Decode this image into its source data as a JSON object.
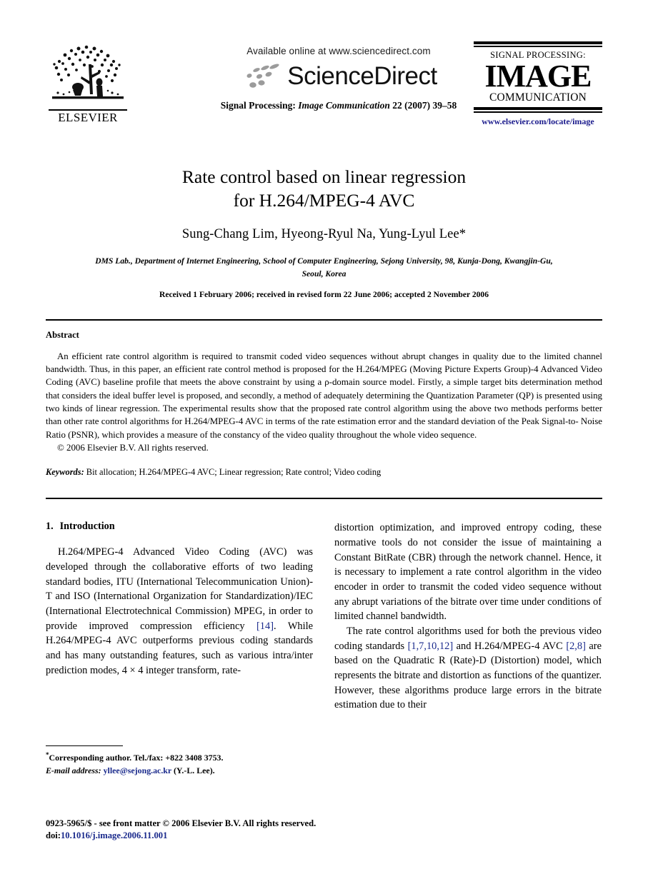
{
  "masthead": {
    "publisher_logo_text": "ELSEVIER",
    "available_online": "Available online at www.sciencedirect.com",
    "sciencedirect_wordmark": "ScienceDirect",
    "journal_ref_prefix": "Signal Processing: ",
    "journal_ref_italic": "Image Communication",
    "journal_ref_suffix": " 22 (2007) 39–58",
    "journal_logo_line1": "SIGNAL PROCESSING:",
    "journal_logo_line2": "IMAGE",
    "journal_logo_line3": "COMMUNICATION",
    "journal_url": "www.elsevier.com/locate/image"
  },
  "article": {
    "title_line1": "Rate control based on linear regression",
    "title_line2": "for H.264/MPEG-4 AVC",
    "authors": "Sung-Chang Lim, Hyeong-Ryul Na, Yung-Lyul Lee*",
    "affiliation_line1": "DMS Lab., Department of Internet Engineering, School of Computer Engineering, Sejong University, 98, Kunja-Dong,",
    "affiliation_line2": "Kwangjin-Gu, Seoul, Korea",
    "history": "Received 1 February 2006; received in revised form 22 June 2006; accepted 2 November 2006"
  },
  "abstract": {
    "heading": "Abstract",
    "paragraph": "An efficient rate control algorithm is required to transmit coded video sequences without abrupt changes in quality due to the limited channel bandwidth. Thus, in this paper, an efficient rate control method is proposed for the H.264/MPEG (Moving Picture Experts Group)-4 Advanced Video Coding (AVC) baseline profile that meets the above constraint by using a ρ-domain source model. Firstly, a simple target bits determination method that considers the ideal buffer level is proposed, and secondly, a method of adequately determining the Quantization Parameter (QP) is presented using two kinds of linear regression. The experimental results show that the proposed rate control algorithm using the above two methods performs better than other rate control algorithms for H.264/MPEG-4 AVC in terms of the rate estimation error and the standard deviation of the Peak Signal-to- Noise Ratio (PSNR), which provides a measure of the constancy of the video quality throughout the whole video sequence.",
    "copyright": "© 2006 Elsevier B.V. All rights reserved.",
    "keywords_label": "Keywords:",
    "keywords_value": " Bit allocation; H.264/MPEG-4 AVC; Linear regression; Rate control; Video coding"
  },
  "body": {
    "section_number": "1.",
    "section_title": "Introduction",
    "left_p1_a": "H.264/MPEG-4 Advanced Video Coding (AVC) was developed through the collaborative efforts of two leading standard bodies, ITU (International Telecommunication Union)-T and ISO (International Organization for Standardization)/IEC (International Electrotechnical Commission) MPEG, in order to provide improved compression efficiency ",
    "left_cite_1": "[14]",
    "left_p1_b": ". While H.264/MPEG-4 AVC outperforms previous coding standards and has many outstanding features, such as various intra/inter prediction modes, 4 × 4 integer transform, rate-",
    "right_p1": "distortion optimization, and improved entropy coding, these normative tools do not consider the issue of maintaining a Constant BitRate (CBR) through the network channel. Hence, it is necessary to implement a rate control algorithm in the video encoder in order to transmit the coded video sequence without any abrupt variations of the bitrate over time under conditions of limited channel bandwidth.",
    "right_p2_a": "The rate control algorithms used for both the previous video coding standards ",
    "right_cite_1": "[1,7,10,12]",
    "right_p2_b": " and H.264/MPEG-4 AVC ",
    "right_cite_2": "[2,8]",
    "right_p2_c": " are based on the Quadratic R (Rate)-D (Distortion) model, which represents the bitrate and distortion as functions of the quantizer. However, these algorithms produce large errors in the bitrate estimation due to their"
  },
  "footnote": {
    "star": "*",
    "corresponding": "Corresponding author. Tel./fax: +822 3408 3753.",
    "email_label": "E-mail address:",
    "email_value": " yllee@sejong.ac.kr",
    "email_suffix": " (Y.-L. Lee)."
  },
  "page_footer": {
    "front_matter": "0923-5965/$ - see front matter © 2006 Elsevier B.V. All rights reserved.",
    "doi_label": "doi:",
    "doi_value": "10.1016/j.image.2006.11.001"
  },
  "colors": {
    "link": "#1a2a8c",
    "journal_url": "#1a1a8c",
    "text": "#000000"
  }
}
